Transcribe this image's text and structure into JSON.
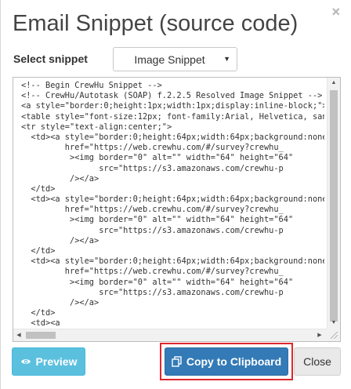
{
  "dialog": {
    "title": "Email Snippet (source code)",
    "close_glyph": "×"
  },
  "snippet": {
    "label": "Select snippet",
    "selected": "Image Snippet"
  },
  "code": {
    "lines": [
      "<!-- Begin CrewHu Snippet -->",
      "<!-- CrewHu/Autotask (SOAP) f.2.2.5 Resolved Image Snippet -->",
      "<a style=\"border:0;height:1px;width:1px;display:inline-block;\"></a>",
      "<table style=\"font-size:12px; font-family:Arial, Helvetica, sans-serif;\">",
      "<tr style=\"text-align:center;\">",
      "  <td><a style=\"border:0;height:64px;width:64px;background:none;\"",
      "         href=\"https://web.crewhu.com/#/survey?crewhu_",
      "          ><img border=\"0\" alt=\"\" width=\"64\" height=\"64\"",
      "                src=\"https://s3.amazonaws.com/crewhu-p",
      "          /></a>",
      "  </td>",
      "  <td><a style=\"border:0;height:64px;width:64px;background:none;\"",
      "         href=\"https://web.crewhu.com/#/survey?crewhu_",
      "          ><img border=\"0\" alt=\"\" width=\"64\" height=\"64\"",
      "                src=\"https://s3.amazonaws.com/crewhu-p",
      "          /></a>",
      "  </td>",
      "  <td><a style=\"border:0;height:64px;width:64px;background:none;\"",
      "         href=\"https://web.crewhu.com/#/survey?crewhu_",
      "          ><img border=\"0\" alt=\"\" width=\"64\" height=\"64\"",
      "                src=\"https://s3.amazonaws.com/crewhu-p",
      "          /></a>",
      "  </td>",
      "  <td><a"
    ]
  },
  "buttons": {
    "preview": "Preview",
    "copy": "Copy to Clipboard",
    "close": "Close"
  },
  "colors": {
    "preview_bg": "#5bc0de",
    "copy_bg": "#337ab7",
    "highlight": "#e0262f"
  }
}
